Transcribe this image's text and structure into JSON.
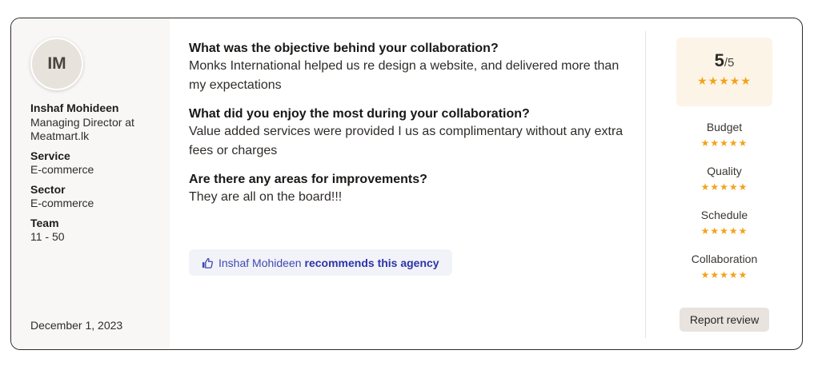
{
  "reviewer": {
    "initials": "IM",
    "name": "Inshaf Mohideen",
    "role": "Managing Director at Meatmart.lk",
    "date": "December 1, 2023"
  },
  "meta": [
    {
      "label": "Service",
      "value": "E-commerce"
    },
    {
      "label": "Sector",
      "value": "E-commerce"
    },
    {
      "label": "Team",
      "value": "11 - 50"
    }
  ],
  "qa": [
    {
      "question": "What was the objective behind your collaboration?",
      "answer": "Monks International helped us re design a website, and delivered more than my expectations"
    },
    {
      "question": "What did you enjoy the most during your collaboration?",
      "answer": "Value added services were provided I us as complimentary without any extra fees or charges"
    },
    {
      "question": "Are there any areas for improvements?",
      "answer": "They are all on the board!!!"
    }
  ],
  "recommendation": {
    "name": "Inshaf Mohideen",
    "text": "recommends this agency",
    "icon": "thumbs-up-icon"
  },
  "score": {
    "value": "5",
    "out_of": "/5",
    "stars": "★★★★★",
    "rating": 5
  },
  "ratings": [
    {
      "label": "Budget",
      "stars": "★★★★★",
      "rating": 5
    },
    {
      "label": "Quality",
      "stars": "★★★★★",
      "rating": 5
    },
    {
      "label": "Schedule",
      "stars": "★★★★★",
      "rating": 5
    },
    {
      "label": "Collaboration",
      "stars": "★★★★★",
      "rating": 5
    }
  ],
  "report_label": "Report review",
  "colors": {
    "star": "#f2a31b",
    "score_bg": "#fdf4e8",
    "sidebar_bg": "#f8f7f5",
    "recommend_bg": "#f1f3f9",
    "recommend_text": "#2d35a6"
  }
}
